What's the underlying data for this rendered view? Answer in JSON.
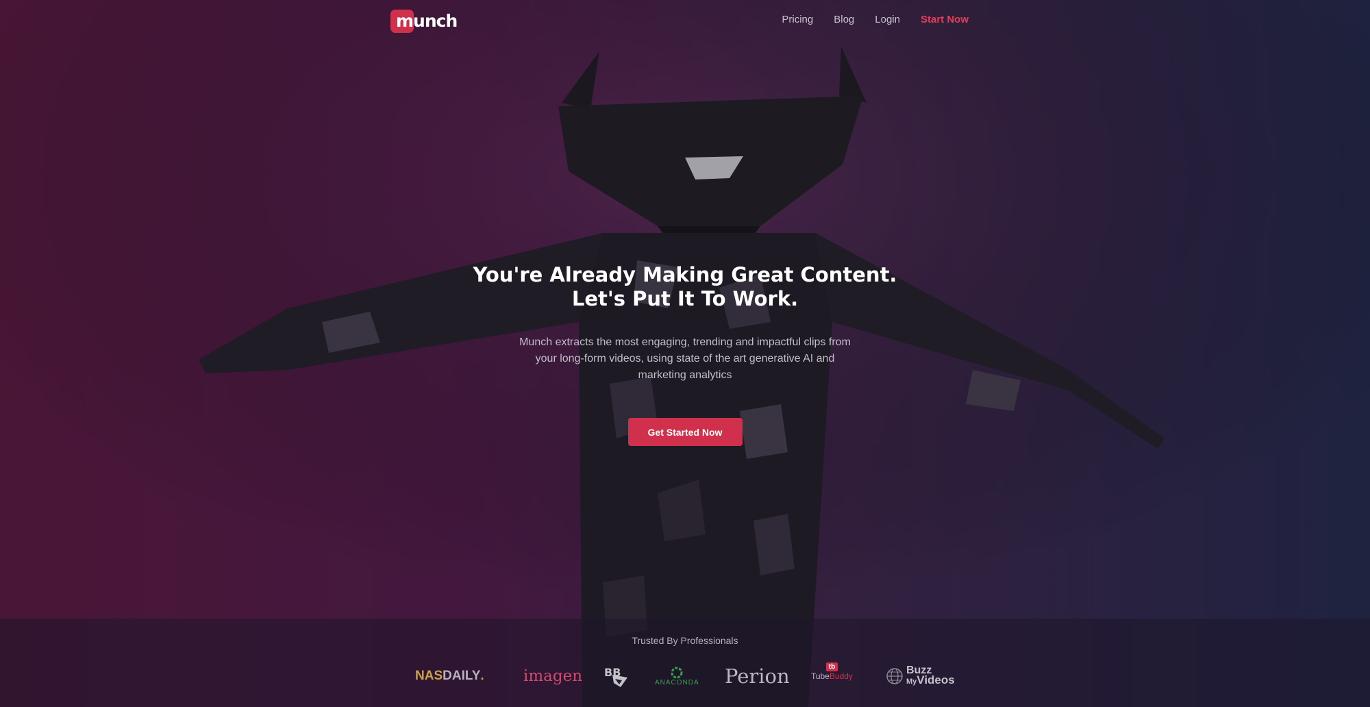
{
  "nav": {
    "logo_text": "munch",
    "links": [
      "Pricing",
      "Blog",
      "Login"
    ],
    "cta": "Start Now"
  },
  "hero": {
    "headline_line1": "You're Already Making Great Content.",
    "headline_line2": "Let's Put It To Work.",
    "subtitle": "Munch extracts the most engaging, trending and impactful clips from your long-form videos, using state of the art generative AI and marketing analytics",
    "button": "Get Started Now"
  },
  "trusted": {
    "title": "Trusted By Professionals",
    "logos": {
      "nasdaily_nas": "NAS",
      "nasdaily_daily": "DAILY",
      "nasdaily_dot": ".",
      "imagen": "imagen",
      "bbs": "BB",
      "anaconda": "ANACONDA",
      "perion": "Perion",
      "tubebuddy_badge": "tb",
      "tubebuddy_tube": "Tube",
      "tubebuddy_buddy": "Buddy",
      "buzz_line1": "Buzz",
      "buzz_line2_my": "My",
      "buzz_line2_videos": "Videos"
    }
  },
  "colors": {
    "accent": "#d0304b",
    "cta_link": "#e0405a",
    "background_left": "#4a1637",
    "background_right": "#1f2340"
  }
}
